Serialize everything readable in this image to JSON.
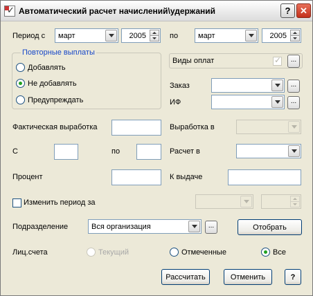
{
  "window": {
    "title": "Автоматический расчет начислений\\удержаний",
    "help_label": "?",
    "close_label": "✕"
  },
  "period": {
    "from_label": "Период с",
    "from_month": "март",
    "from_year": "2005",
    "to_label": "по",
    "to_month": "март",
    "to_year": "2005"
  },
  "repeat_payments": {
    "title": "Повторные выплаты",
    "options": [
      "Добавлять",
      "Не добавлять",
      "Предупреждать"
    ],
    "selected_index": 1
  },
  "payment_types": {
    "label": "Виды оплат",
    "checked": true
  },
  "order": {
    "label": "Заказ",
    "value": ""
  },
  "source": {
    "label": "ИФ",
    "value": ""
  },
  "output": {
    "actual_label": "Фактическая выработка",
    "actual_value": "",
    "output_in_label": "Выработка в",
    "from_label": "С",
    "to_label": "по",
    "calc_in_label": "Расчет в",
    "percent_label": "Процент",
    "payout_label": "К выдаче"
  },
  "change_period": {
    "label": "Изменить период за",
    "checked": false
  },
  "department": {
    "label": "Подразделение",
    "value": "Вся организация",
    "select_button": "Отобрать"
  },
  "accounts": {
    "label": "Лиц.счета",
    "options": [
      "Текущий",
      "Отмеченные",
      "Все"
    ],
    "selected_index": 2
  },
  "footer": {
    "calculate": "Рассчитать",
    "cancel": "Отменить",
    "help": "?"
  }
}
